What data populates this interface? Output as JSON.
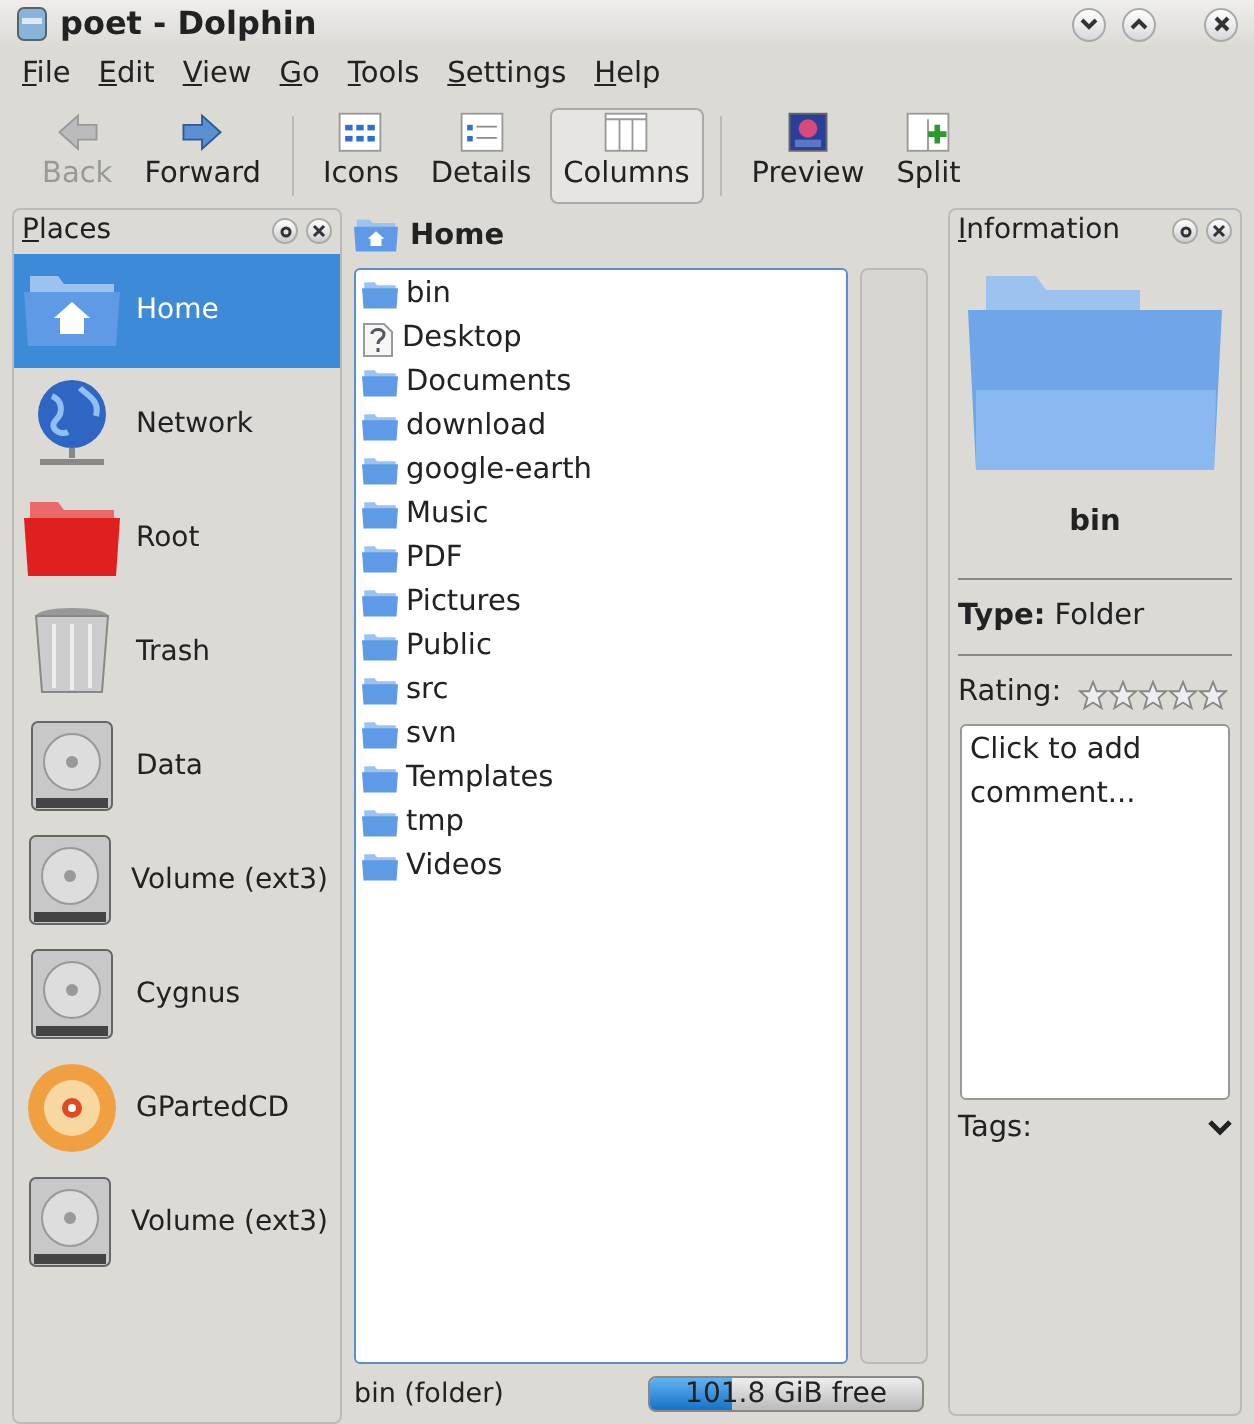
{
  "window": {
    "title": "poet - Dolphin"
  },
  "menu": [
    "File",
    "Edit",
    "View",
    "Go",
    "Tools",
    "Settings",
    "Help"
  ],
  "toolbar": [
    {
      "kind": "back",
      "label": "Back",
      "disabled": true,
      "selected": false
    },
    {
      "kind": "forward",
      "label": "Forward",
      "disabled": false,
      "selected": false
    },
    {
      "kind": "separator"
    },
    {
      "kind": "icons",
      "label": "Icons",
      "disabled": false,
      "selected": false
    },
    {
      "kind": "details",
      "label": "Details",
      "disabled": false,
      "selected": false
    },
    {
      "kind": "columns",
      "label": "Columns",
      "disabled": false,
      "selected": true
    },
    {
      "kind": "separator"
    },
    {
      "kind": "preview",
      "label": "Preview",
      "disabled": false,
      "selected": false
    },
    {
      "kind": "split",
      "label": "Split",
      "disabled": false,
      "selected": false
    }
  ],
  "places": {
    "title": "Places",
    "items": [
      {
        "kind": "home",
        "label": "Home",
        "selected": true
      },
      {
        "kind": "network",
        "label": "Network",
        "selected": false
      },
      {
        "kind": "root",
        "label": "Root",
        "selected": false
      },
      {
        "kind": "trash",
        "label": "Trash",
        "selected": false
      },
      {
        "kind": "drive",
        "label": "Data",
        "selected": false
      },
      {
        "kind": "drive",
        "label": "Volume (ext3)",
        "selected": false
      },
      {
        "kind": "drive",
        "label": "Cygnus",
        "selected": false
      },
      {
        "kind": "cd",
        "label": "GPartedCD",
        "selected": false
      },
      {
        "kind": "drive",
        "label": "Volume (ext3)",
        "selected": false
      }
    ]
  },
  "column": {
    "title": "Home",
    "files": [
      {
        "kind": "folder",
        "name": "bin"
      },
      {
        "kind": "unknown",
        "name": "Desktop"
      },
      {
        "kind": "folder",
        "name": "Documents"
      },
      {
        "kind": "folder",
        "name": "download"
      },
      {
        "kind": "folder",
        "name": "google-earth"
      },
      {
        "kind": "folder",
        "name": "Music"
      },
      {
        "kind": "folder",
        "name": "PDF"
      },
      {
        "kind": "folder",
        "name": "Pictures"
      },
      {
        "kind": "folder",
        "name": "Public"
      },
      {
        "kind": "folder",
        "name": "src"
      },
      {
        "kind": "folder",
        "name": "svn"
      },
      {
        "kind": "folder",
        "name": "Templates"
      },
      {
        "kind": "folder",
        "name": "tmp"
      },
      {
        "kind": "folder",
        "name": "Videos"
      }
    ]
  },
  "status_bar": {
    "text": "bin (folder)",
    "free_space": {
      "reading": "101.8 GiB free",
      "level": 0.3
    }
  },
  "information": {
    "title": "Information",
    "name": "bin",
    "type_label": "Type:",
    "type_value": "Folder",
    "rating_label": "Rating:",
    "stars": 0,
    "comment": {
      "placeholder": "Click to add comment..."
    },
    "tags_label": "Tags:"
  }
}
